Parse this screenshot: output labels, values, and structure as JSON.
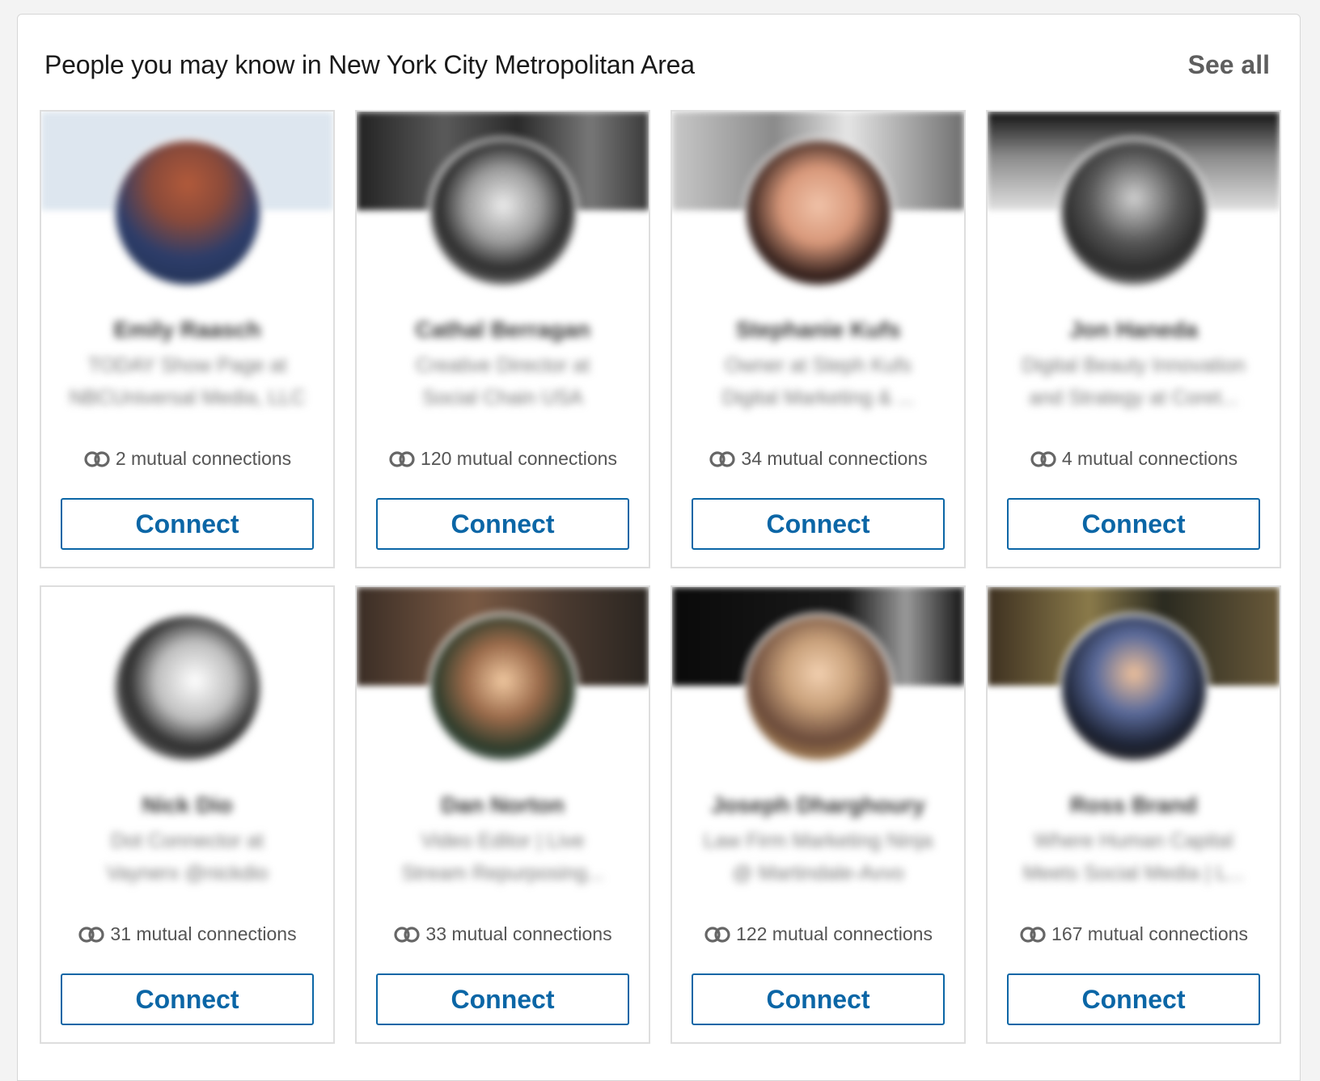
{
  "header": {
    "title": "People you may know in New York City Metropolitan Area",
    "see_all": "See all"
  },
  "cards": [
    {
      "name": "Emily Raasch",
      "headline_1": "TODAY Show Page at",
      "headline_2": "NBCUniversal Media, LLC",
      "mutual": "2 mutual connections",
      "connect": "Connect"
    },
    {
      "name": "Cathal Berragan",
      "headline_1": "Creative Director at",
      "headline_2": "Social Chain USA",
      "mutual": "120 mutual connections",
      "connect": "Connect"
    },
    {
      "name": "Stephanie Kufs",
      "headline_1": "Owner at Steph Kufs",
      "headline_2": "Digital Marketing & ...",
      "mutual": "34 mutual connections",
      "connect": "Connect"
    },
    {
      "name": "Jon Haneda",
      "headline_1": "Digital Beauty Innovation",
      "headline_2": "and Strategy at Coret...",
      "mutual": "4 mutual connections",
      "connect": "Connect"
    },
    {
      "name": "Nick Dio",
      "headline_1": "Dot Connector at",
      "headline_2": "Vaynerx @nickdio",
      "mutual": "31 mutual connections",
      "connect": "Connect"
    },
    {
      "name": "Dan Norton",
      "headline_1": "Video Editor | Live",
      "headline_2": "Stream Repurposing...",
      "mutual": "33 mutual connections",
      "connect": "Connect"
    },
    {
      "name": "Joseph Dharghoury",
      "headline_1": "Law Firm Marketing Ninja",
      "headline_2": "@ Martindale-Avvo",
      "mutual": "122 mutual connections",
      "connect": "Connect"
    },
    {
      "name": "Ross Brand",
      "headline_1": "Where Human Capital",
      "headline_2": "Meets Social Media | L...",
      "mutual": "167 mutual connections",
      "connect": "Connect"
    }
  ],
  "icons": {
    "mutual": "mutual-connections-icon"
  },
  "colors": {
    "accent": "#0b66a6",
    "see_all": "#5e5e5e",
    "text_secondary": "#555555"
  }
}
